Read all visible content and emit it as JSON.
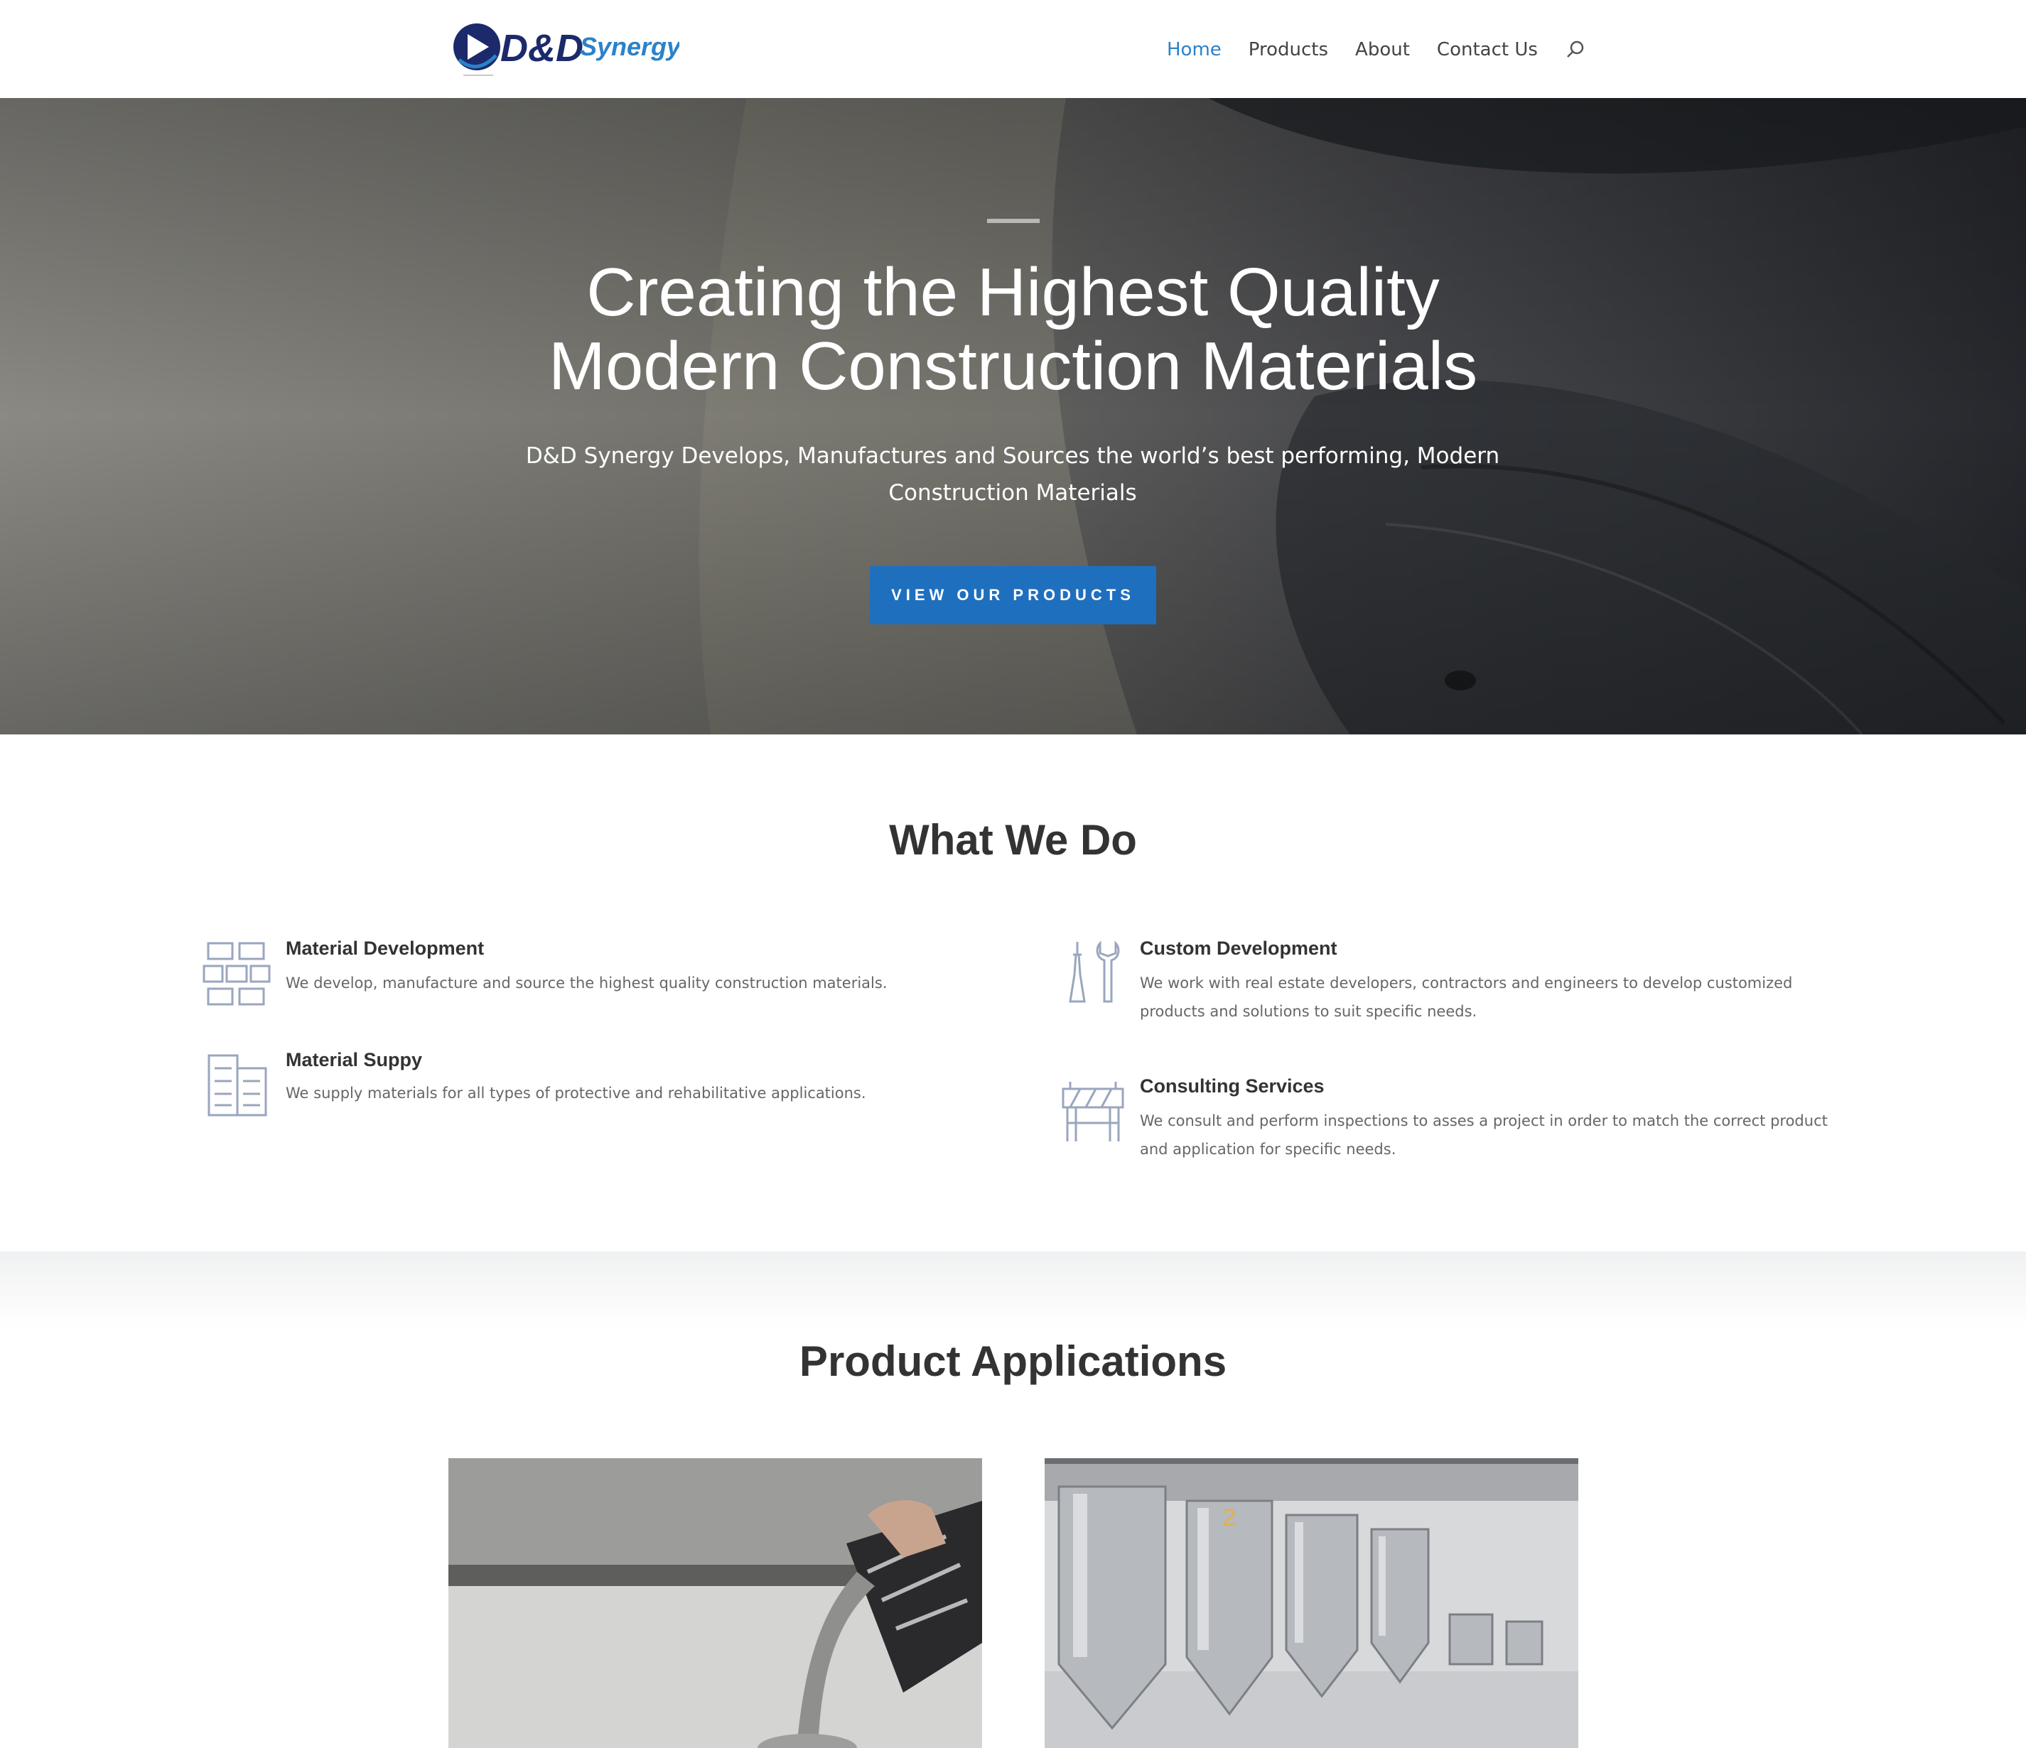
{
  "brand": {
    "name_part1": "D&D",
    "name_part2": "Synergy",
    "accent": "#2b82c9",
    "navy": "#1c2a6b"
  },
  "nav": {
    "items": [
      {
        "label": "Home",
        "active": true
      },
      {
        "label": "Products",
        "active": false
      },
      {
        "label": "About",
        "active": false
      },
      {
        "label": "Contact Us",
        "active": false
      }
    ]
  },
  "hero": {
    "title_line1": "Creating the Highest Quality",
    "title_line2": "Modern Construction Materials",
    "subtitle": "D&D Synergy Develops, Manufactures and Sources the world’s best performing, Modern Construction Materials",
    "button_label": "VIEW OUR PRODUCTS",
    "button_color": "#1f6fbf"
  },
  "what_we_do": {
    "title": "What We Do",
    "services": [
      {
        "icon": "bricks-icon",
        "title": "Material Development",
        "description": "We develop, manufacture and source the highest quality construction materials."
      },
      {
        "icon": "tools-icon",
        "title": "Custom Development",
        "description": "We work with real estate developers, contractors and engineers to develop customized products and solutions to suit specific needs."
      },
      {
        "icon": "building-icon",
        "title": "Material Suppy",
        "description": "We supply materials for all types of protective and rehabilitative applications."
      },
      {
        "icon": "barrier-icon",
        "title": "Consulting Services",
        "description": "We consult and perform inspections to asses a project in order to match the correct product and application for specific needs."
      }
    ]
  },
  "product_applications": {
    "title": "Product Applications",
    "images": [
      {
        "name": "pouring-coating-image"
      },
      {
        "name": "steel-tanks-image"
      }
    ]
  }
}
